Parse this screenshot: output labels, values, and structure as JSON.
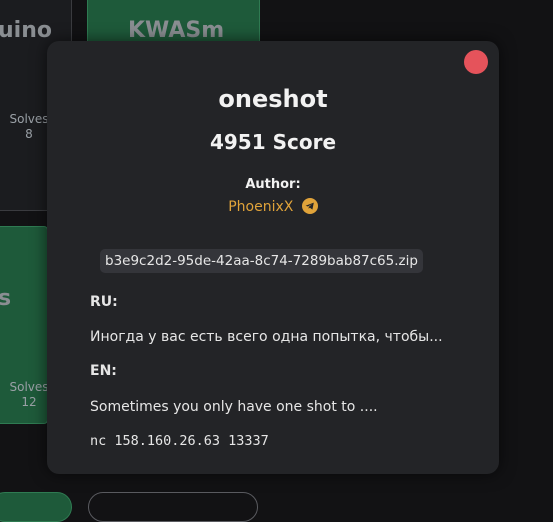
{
  "background": {
    "card_left_top_title": "uino",
    "card_right_top_title": "KWASm",
    "card_left_top_solves_label": "Solves",
    "card_left_top_solves_count": "8",
    "card_left_mid_title": "s",
    "card_left_mid_solves_label": "Solves",
    "card_left_mid_solves_count": "12"
  },
  "modal": {
    "challenge_name": "oneshot",
    "score": "4951 Score",
    "author_label": "Author:",
    "author_name": "PhoenixX",
    "author_icon": "telegram-icon",
    "file_name": "b3e9c2d2-95de-42aa-8c74-7289bab87c65.zip",
    "ru_label": "RU:",
    "ru_text": "Иногда у вас есть всего одна попытка, чтобы...",
    "en_label": "EN:",
    "en_text": "Sometimes you only have one shot to ....",
    "connection": "nc 158.160.26.63 13337"
  },
  "colors": {
    "close": "#e5535b",
    "author_link": "#e0a33a",
    "solved_card": "#1e5a3a",
    "modal_bg": "#232427"
  }
}
